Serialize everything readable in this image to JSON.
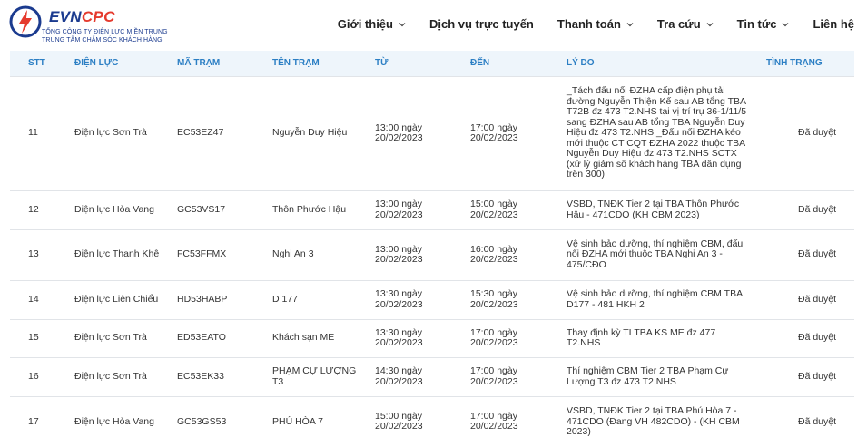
{
  "brand": {
    "evn": "EVN",
    "cpc": "CPC",
    "line1": "TỔNG CÔNG TY ĐIỆN LỰC MIỀN TRUNG",
    "line2": "TRUNG TÂM CHĂM SÓC KHÁCH HÀNG",
    "colors": {
      "blue": "#1b3b8f",
      "red": "#e53a2d"
    }
  },
  "nav": {
    "items": [
      {
        "label": "Giới thiệu",
        "has_dropdown": true
      },
      {
        "label": "Dịch vụ trực tuyến",
        "has_dropdown": false
      },
      {
        "label": "Thanh toán",
        "has_dropdown": true
      },
      {
        "label": "Tra cứu",
        "has_dropdown": true
      },
      {
        "label": "Tin tức",
        "has_dropdown": true
      },
      {
        "label": "Liên hệ",
        "has_dropdown": false
      }
    ]
  },
  "table": {
    "header_color": "#2c7fc4",
    "columns": [
      "STT",
      "ĐIỆN LỰC",
      "MÃ TRẠM",
      "TÊN TRẠM",
      "TỪ",
      "ĐẾN",
      "LÝ DO",
      "TÌNH TRẠNG"
    ],
    "rows": [
      {
        "stt": "11",
        "dien_luc": "Điện lực Sơn Trà",
        "ma_tram": "EC53EZ47",
        "ten_tram": "Nguyễn Duy Hiệu",
        "tu": "13:00 ngày 20/02/2023",
        "den": "17:00 ngày 20/02/2023",
        "ly_do": "_Tách đấu nối ĐZHA cấp điện phụ tải đường Nguyễn Thiện Kế sau AB tổng TBA T72B đz 473 T2.NHS tại vị trí trụ 36-1/11/5 sang ĐZHA sau AB tổng TBA Nguyễn Duy Hiệu đz 473 T2.NHS _Đấu nối ĐZHA kéo mới thuộc CT CQT ĐZHA 2022 thuộc TBA Nguyễn Duy Hiệu đz 473 T2.NHS SCTX (xử lý giảm số khách hàng TBA dân dụng trên 300)",
        "tinh_trang": "Đã duyệt",
        "height": 126
      },
      {
        "stt": "12",
        "dien_luc": "Điện lực Hòa Vang",
        "ma_tram": "GC53VS17",
        "ten_tram": "Thôn Phước Hậu",
        "tu": "13:00 ngày 20/02/2023",
        "den": "15:00 ngày 20/02/2023",
        "ly_do": "VSBD, TNĐK Tier 2 tại TBA Thôn Phước Hậu - 471CDO (KH CBM 2023)",
        "tinh_trang": "Đã duyệt",
        "height": 43
      },
      {
        "stt": "13",
        "dien_luc": "Điện lực Thanh Khê",
        "ma_tram": "FC53FFMX",
        "ten_tram": "Nghi An 3",
        "tu": "13:00 ngày 20/02/2023",
        "den": "16:00 ngày 20/02/2023",
        "ly_do": "Vệ sinh bảo dưỡng, thí nghiệm CBM, đấu nối ĐZHA mới thuộc TBA Nghi An 3 - 475/CĐO",
        "tinh_trang": "Đã duyệt",
        "height": 56
      },
      {
        "stt": "14",
        "dien_luc": "Điện lực Liên Chiểu",
        "ma_tram": "HD53HABP",
        "ten_tram": "D 177",
        "tu": "13:30 ngày 20/02/2023",
        "den": "15:30 ngày 20/02/2023",
        "ly_do": "Vệ sinh bảo dưỡng, thí nghiệm CBM TBA D177 - 481 HKH 2",
        "tinh_trang": "Đã duyệt",
        "height": 43
      },
      {
        "stt": "15",
        "dien_luc": "Điện lực Sơn Trà",
        "ma_tram": "ED53EATO",
        "ten_tram": "Khách sạn ME",
        "tu": "13:30 ngày 20/02/2023",
        "den": "17:00 ngày 20/02/2023",
        "ly_do": "Thay định kỳ TI TBA KS ME đz 477 T2.NHS",
        "tinh_trang": "Đã duyệt",
        "height": 42
      },
      {
        "stt": "16",
        "dien_luc": "Điện lực Sơn Trà",
        "ma_tram": "EC53EK33",
        "ten_tram": "PHẠM CỰ LƯỢNG T3",
        "tu": "14:30 ngày 20/02/2023",
        "den": "17:00 ngày 20/02/2023",
        "ly_do": "Thí nghiệm CBM Tier 2 TBA Phạm Cự Lượng T3 đz 473 T2.NHS",
        "tinh_trang": "Đã duyệt",
        "height": 43
      },
      {
        "stt": "17",
        "dien_luc": "Điện lực Hòa Vang",
        "ma_tram": "GC53GS53",
        "ten_tram": "PHÚ HÒA 7",
        "tu": "15:00 ngày 20/02/2023",
        "den": "17:00 ngày 20/02/2023",
        "ly_do": "VSBD, TNĐK Tier 2 tại TBA Phú Hòa 7 - 471CDO (Đang VH 482CDO) - (KH CBM 2023)",
        "tinh_trang": "Đã duyệt",
        "height": 56
      }
    ]
  }
}
